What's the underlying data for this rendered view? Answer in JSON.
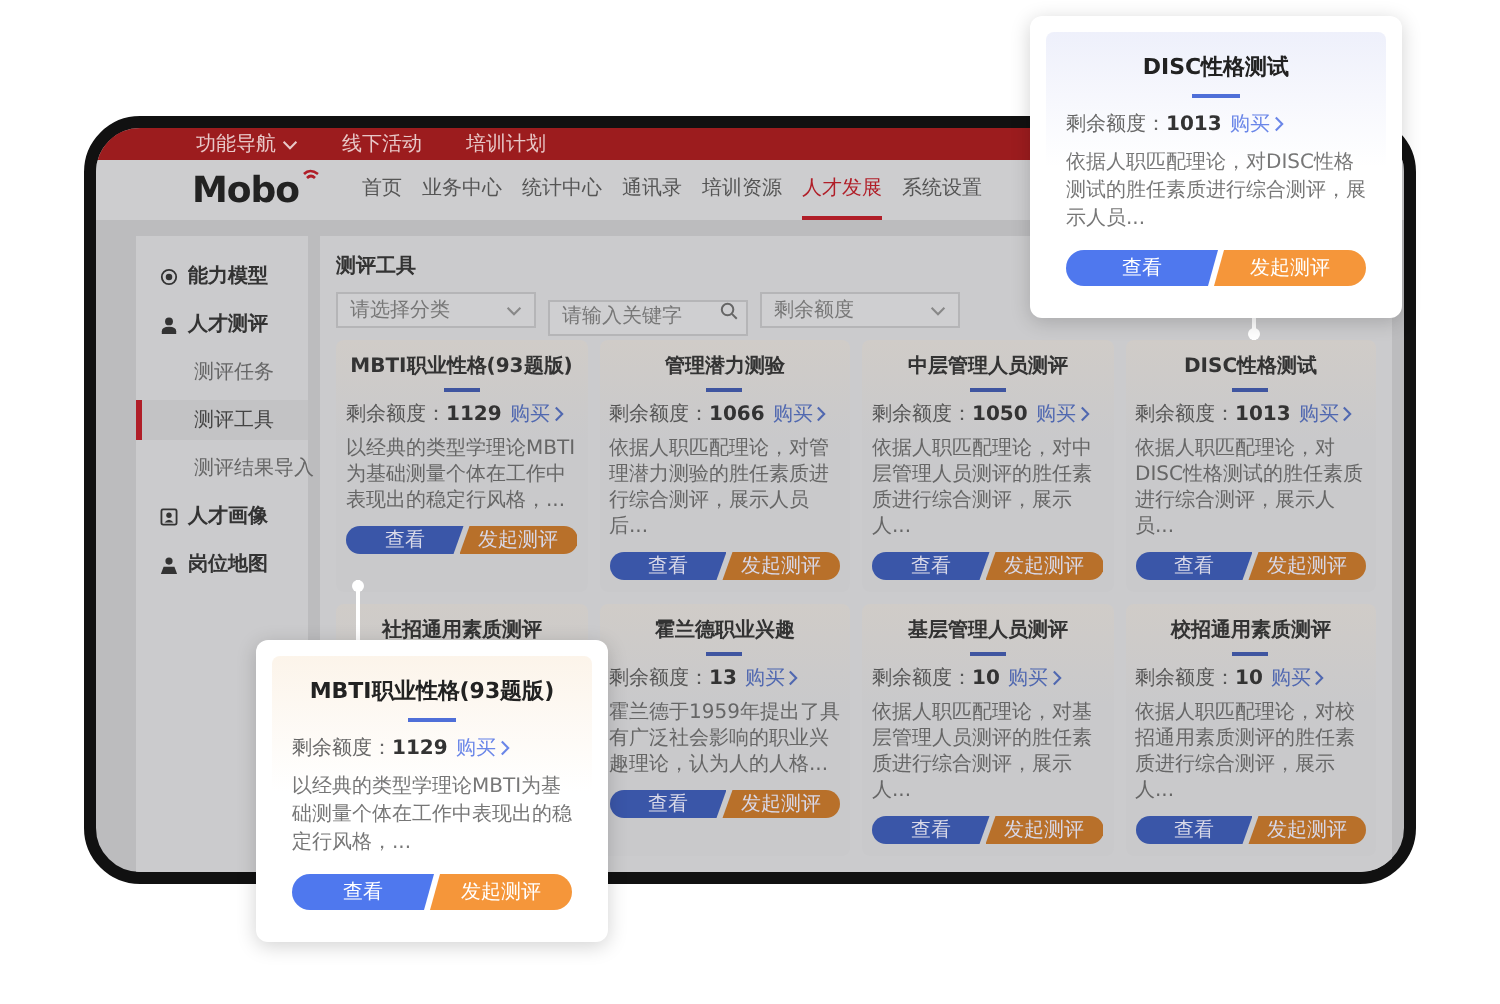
{
  "top_bar": {
    "items": [
      {
        "label": "功能导航",
        "dropdown": true
      },
      {
        "label": "线下活动",
        "dropdown": false
      },
      {
        "label": "培训计划",
        "dropdown": false
      }
    ]
  },
  "header": {
    "logo": "Mobo",
    "nav": [
      {
        "label": "首页",
        "selected": false
      },
      {
        "label": "业务中心",
        "selected": false
      },
      {
        "label": "统计中心",
        "selected": false
      },
      {
        "label": "通讯录",
        "selected": false
      },
      {
        "label": "培训资源",
        "selected": false
      },
      {
        "label": "人才发展",
        "selected": true
      },
      {
        "label": "系统设置",
        "selected": false
      }
    ]
  },
  "sidebar": {
    "items": [
      {
        "label": "能力模型"
      },
      {
        "label": "人才测评",
        "children": [
          {
            "label": "测评任务",
            "selected": false
          },
          {
            "label": "测评工具",
            "selected": true
          },
          {
            "label": "测评结果导入",
            "selected": false
          }
        ]
      },
      {
        "label": "人才画像"
      },
      {
        "label": "岗位地图"
      }
    ]
  },
  "main": {
    "title": "测评工具",
    "filters": [
      {
        "kind": "select",
        "placeholder": "请选择分类"
      },
      {
        "kind": "search",
        "placeholder": "请输入关键字"
      },
      {
        "kind": "select",
        "placeholder": "剩余额度"
      }
    ],
    "cards": [
      {
        "title": "MBTI职业性格(93题版)",
        "quota": "剩余额度：**1129**",
        "buy": "购买",
        "description": "以经典的类型学理论MBTI为基础测量个体在工作中表现出的稳定行风格，...",
        "view": "查看",
        "start": "发起测评"
      },
      {
        "title": "管理潜力测验",
        "quota": "剩余额度：**1066**",
        "buy": "购买",
        "description": "依据人职匹配理论，对管理潜力测验的胜任素质进行综合测评，展示人员后...",
        "view": "查看",
        "start": "发起测评"
      },
      {
        "title": "中层管理人员测评",
        "quota": "剩余额度：**1050**",
        "buy": "购买",
        "description": "依据人职匹配理论，对中层管理人员测评的胜任素质进行综合测评，展示人...",
        "view": "查看",
        "start": "发起测评"
      },
      {
        "title": "DISC性格测试",
        "quota": "剩余额度：**1013**",
        "buy": "购买",
        "description": "依据人职匹配理论，对DISC性格测试的胜任素质进行综合测评，展示人员...",
        "view": "查看",
        "start": "发起测评"
      },
      {
        "title": "社招通用素质测评"
      },
      {
        "title": "霍兰德职业兴趣",
        "quota": "剩余额度：**13**",
        "buy": "购买",
        "description": "霍兰德于1959年提出了具有广泛社会影响的职业兴趣理论，认为人的人格...",
        "view": "查看",
        "start": "发起测评"
      },
      {
        "title": "基层管理人员测评",
        "quota": "剩余额度：**10**",
        "buy": "购买",
        "description": "依据人职匹配理论，对基层管理人员测评的胜任素质进行综合测评，展示人...",
        "view": "查看",
        "start": "发起测评"
      },
      {
        "title": "校招通用素质测评",
        "quota": "剩余额度：**10**",
        "buy": "购买",
        "description": "依据人职匹配理论，对校招通用素质测评的胜任素质进行综合测评，展示人...",
        "view": "查看",
        "start": "发起测评"
      }
    ]
  },
  "callouts": [
    {
      "title": "DISC性格测试",
      "quota": "剩余额度：**1013**",
      "buy": "购买",
      "description": "依据人职匹配理论，对DISC性格测试的胜任素质进行综合测评，展示人员...",
      "view": "查看",
      "start": "发起测评"
    },
    {
      "title": "MBTI职业性格(93题版)",
      "quota": "剩余额度：**1129**",
      "buy": "购买",
      "description": "以经典的类型学理论MBTI为基础测量个体在工作中表现出的稳定行风格，...",
      "view": "查看",
      "start": "发起测评"
    }
  ]
}
